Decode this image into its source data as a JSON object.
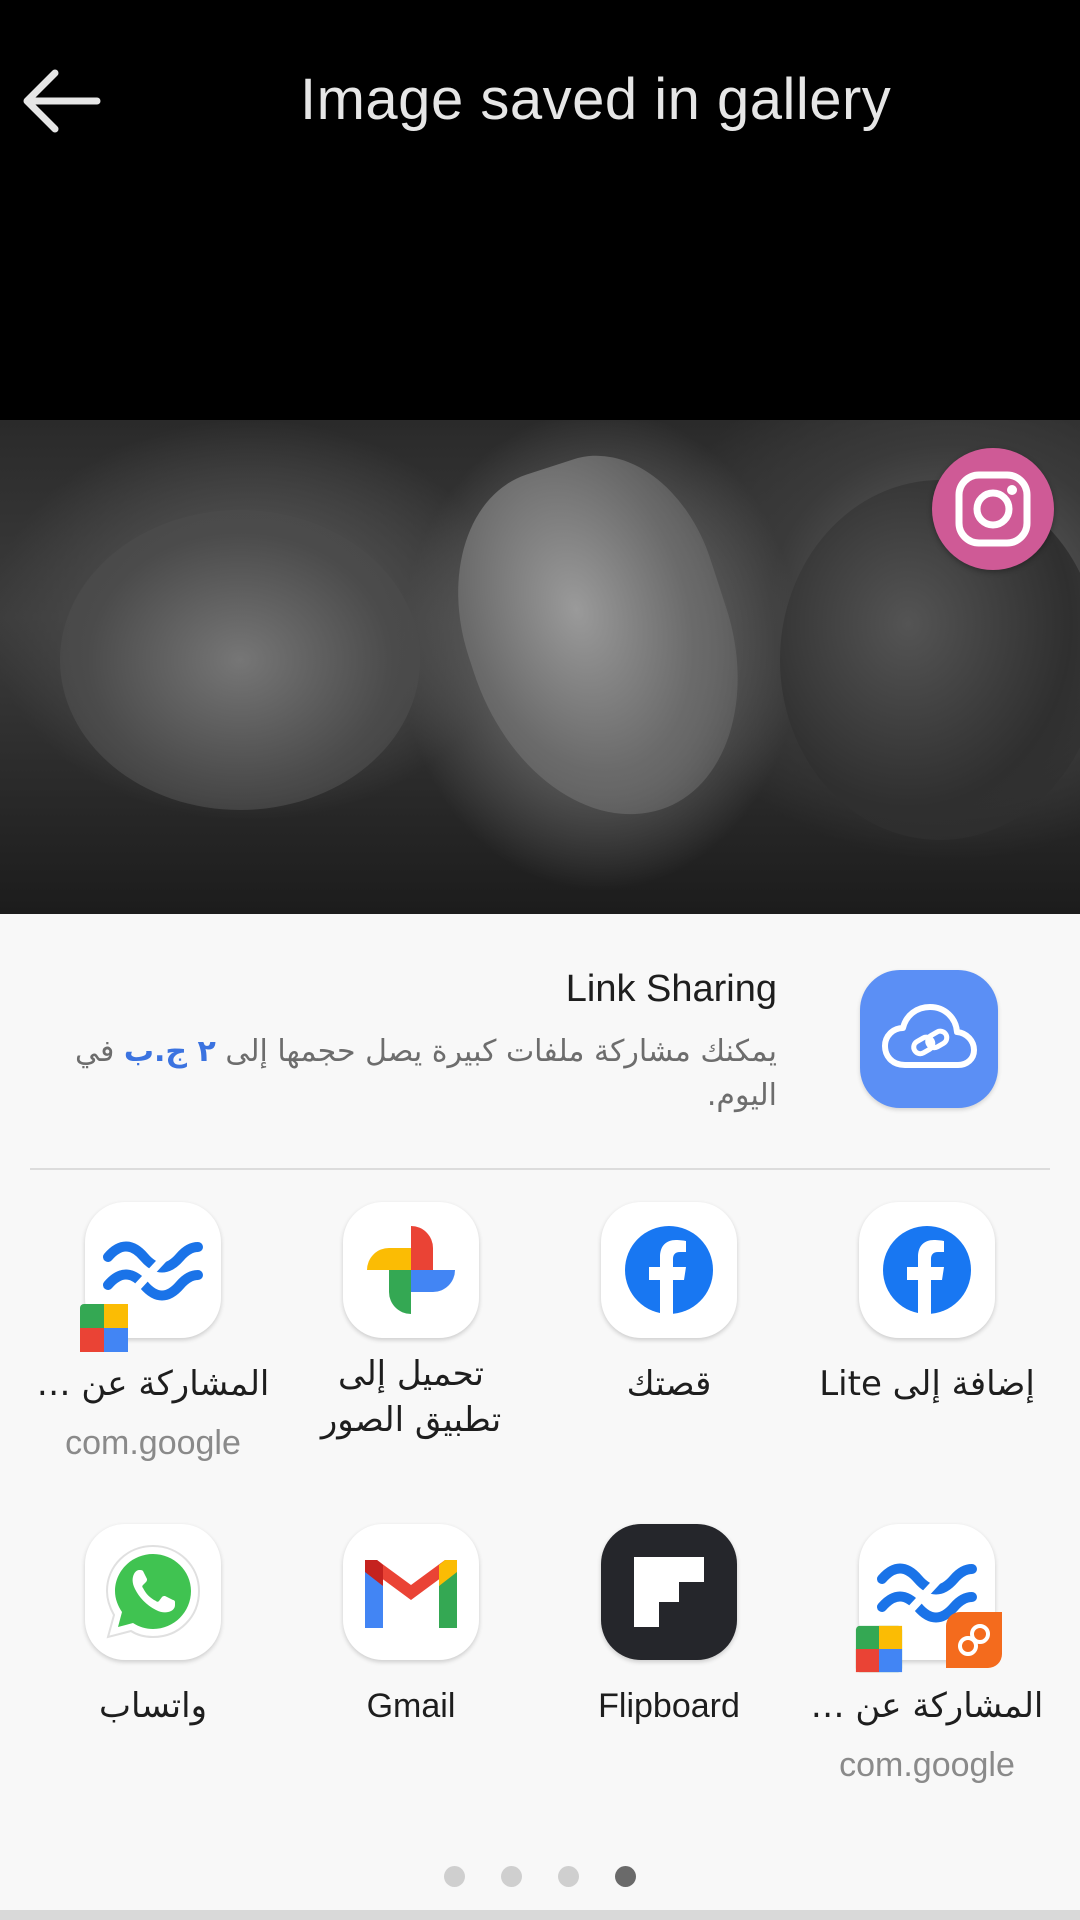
{
  "header": {
    "title": "Image saved in gallery"
  },
  "link_sharing": {
    "title": "Link Sharing",
    "desc_before": "يمكنك مشاركة ملفات كبيرة يصل حجمها إلى ",
    "desc_highlight": "٢ ج.ب",
    "desc_after": " في اليوم."
  },
  "apps": [
    {
      "label": "إضافة إلى Lite",
      "sub": ""
    },
    {
      "label": "قصتك",
      "sub": ""
    },
    {
      "label": "تحميل إلى",
      "label2": "تطبيق الصور",
      "sub": ""
    },
    {
      "label": "المشاركة عن …",
      "sub": "com.google"
    },
    {
      "label": "المشاركة عن …",
      "sub": "com.google"
    },
    {
      "label": "Flipboard",
      "sub": ""
    },
    {
      "label": "Gmail",
      "sub": ""
    },
    {
      "label": "واتساب",
      "sub": ""
    }
  ],
  "page_indicator": {
    "total": 4,
    "active": 4
  },
  "colors": {
    "link_icon_bg": "#5b8ff5",
    "instagram_button": "#cf5a96",
    "highlight_text": "#3b73e0"
  }
}
